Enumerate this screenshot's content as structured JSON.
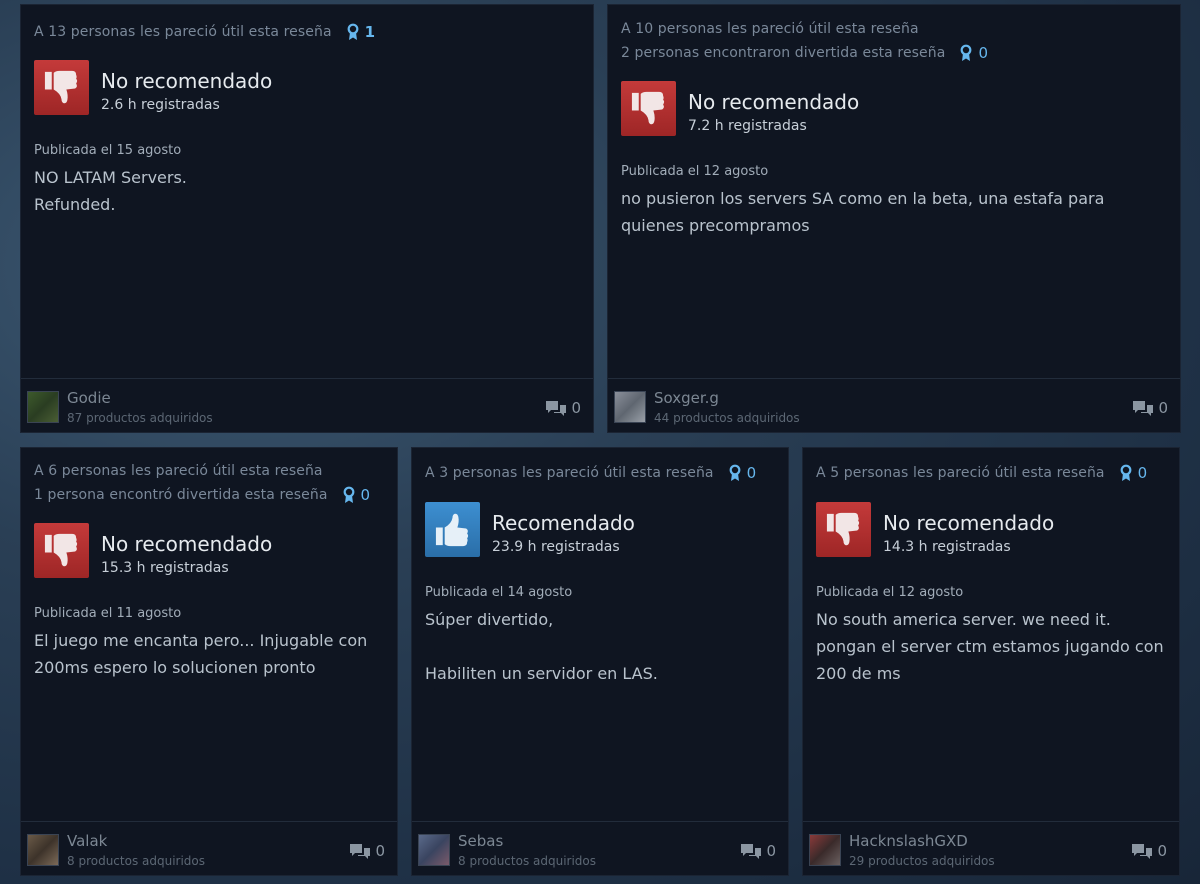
{
  "reviews": [
    {
      "helpful": "A 13 personas les pareció útil esta reseña",
      "funny": "",
      "award_count": "1",
      "verdict": "No recomendado",
      "hours": "2.6 h registradas",
      "date": "Publicada el 15 agosto",
      "body": "NO LATAM Servers.\nRefunded.",
      "user": "Godie",
      "products": "87 productos adquiridos",
      "comments": "0"
    },
    {
      "helpful": "A 10 personas les pareció útil esta reseña",
      "funny": "2 personas encontraron divertida esta reseña",
      "award_count": "0",
      "verdict": "No recomendado",
      "hours": "7.2 h registradas",
      "date": "Publicada el 12 agosto",
      "body": "no pusieron los servers SA como en la beta, una estafa para\nquienes precompramos",
      "user": "Soxger.g",
      "products": "44 productos adquiridos",
      "comments": "0"
    },
    {
      "helpful": "A 6 personas les pareció útil esta reseña",
      "funny": "1 persona encontró divertida esta reseña",
      "award_count": "0",
      "verdict": "No recomendado",
      "hours": "15.3 h registradas",
      "date": "Publicada el 11 agosto",
      "body": "El juego me encanta pero... Injugable con\n200ms espero lo solucionen pronto",
      "user": "Valak",
      "products": "8 productos adquiridos",
      "comments": "0"
    },
    {
      "helpful": "A 3 personas les pareció útil esta reseña",
      "funny": "",
      "award_count": "0",
      "verdict": "Recomendado",
      "hours": "23.9 h registradas",
      "date": "Publicada el 14 agosto",
      "body": "Súper divertido,\n\nHabiliten un servidor en LAS.",
      "user": "Sebas",
      "products": "8 productos adquiridos",
      "comments": "0"
    },
    {
      "helpful": "A 5 personas les pareció útil esta reseña",
      "funny": "",
      "award_count": "0",
      "verdict": "No recomendado",
      "hours": "14.3 h registradas",
      "date": "Publicada el 12 agosto",
      "body": "No south america server. we need it.\npongan el server ctm estamos jugando con\n200 de ms",
      "user": "HacknslashGXD",
      "products": "29 productos adquiridos",
      "comments": "0"
    }
  ],
  "icons": {
    "thumbs_down": "thumbs-down-icon",
    "thumbs_up": "thumbs-up-icon",
    "award": "award-ribbon-icon",
    "comment": "comment-bubbles-icon"
  },
  "colors": {
    "negative": "#b32e2e",
    "positive": "#3d8fd1",
    "award": "#66b7ee",
    "card_bg": "#0f1521"
  }
}
